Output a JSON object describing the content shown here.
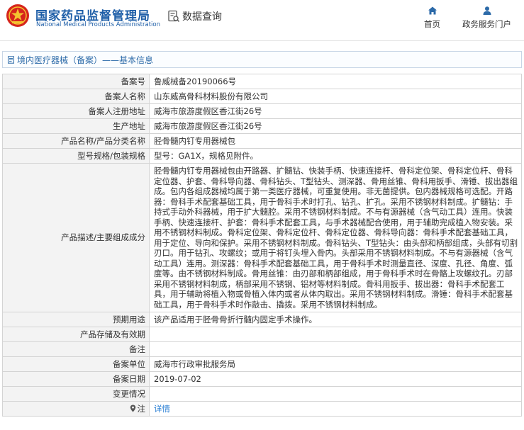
{
  "header": {
    "brand_cn": "国家药品监督管理局",
    "brand_en": "National Medical Products Administration",
    "section_title": "数据查询",
    "nav": [
      {
        "label": "首页",
        "icon": "home-icon"
      },
      {
        "label": "政务服务门户",
        "icon": "user-icon"
      }
    ]
  },
  "breadcrumb": {
    "text": "境内医疗器械（备案）——基本信息"
  },
  "record": {
    "rows": [
      {
        "key": "备案号",
        "value": "鲁威械备20190066号"
      },
      {
        "key": "备案人名称",
        "value": "山东威高骨科材料股份有限公司"
      },
      {
        "key": "备案人注册地址",
        "value": "威海市旅游度假区香江街26号"
      },
      {
        "key": "生产地址",
        "value": "威海市旅游度假区香江街26号"
      },
      {
        "key": "产品名称/产品分类名称",
        "value": "胫骨髓内钉专用器械包"
      },
      {
        "key": "型号规格/包装规格",
        "value": "型号：GA1X，规格见附件。"
      },
      {
        "key": "产品描述/主要组成成分",
        "value": "胫骨髓内钉专用器械包由开路器、扩髓钻、快装手柄、快速连接杆、骨科定位架、骨科定位杆、骨科定位器、护套、骨科导向器、骨科钻头、T型钻头、测深器、骨用丝锥、骨科用扳手、滑锤、拔出器组成。包内各组成器械均属于第一类医疗器械，可重复使用。非无菌提供。包内器械规格可选配。开路器：骨科手术配套基础工具，用于骨科手术时打孔、钻孔、扩孔。采用不锈钢材料制成。扩髓钻：手持式手动外科器械，用于扩大髓腔。采用不锈钢材料制成。不与有源器械（含气动工具）连用。快装手柄、快速连接杆、护套：骨科手术配套工具，与手术器械配合使用，用于辅助完成植入物安装。采用不锈钢材料制成。骨科定位架、骨科定位杆、骨科定位器、骨科导向器：骨科手术配套基础工具，用于定位、导向和保护。采用不锈钢材料制成。骨科钻头、T型钻头：由头部和柄部组成，头部有切割刃口。用于钻孔、攻螺纹；或用于将钉头埋入骨内。头部采用不锈钢材料制成。不与有源器械（含气动工具）连用。测深器：骨科手术配套基础工具，用于骨科手术时测量直径、深度、孔径、角度、弧度等。由不锈钢材料制成。骨用丝锥：由刃部和柄部组成，用于骨科手术时在骨骼上攻螺纹孔。刃部采用不锈钢材料制成，柄部采用不锈钢、铝材等材料制成。骨科用扳手、拔出器：骨科手术配套工具，用于辅助将植入物或骨植入体内或者从体内取出。采用不锈钢材料制成。滑锤：骨科手术配套基础工具，用于骨科手术时作敲击、撬拨。采用不锈钢材料制成。"
      },
      {
        "key": "预期用途",
        "value": "该产品适用于胫骨骨折行髓内固定手术操作。"
      },
      {
        "key": "产品存储及有效期",
        "value": ""
      },
      {
        "key": "备注",
        "value": ""
      },
      {
        "key": "备案单位",
        "value": "威海市行政审批服务局"
      },
      {
        "key": "备案日期",
        "value": "2019-07-02"
      },
      {
        "key": "变更情况",
        "value": ""
      }
    ],
    "note": {
      "key": "注",
      "link": "详情"
    }
  }
}
